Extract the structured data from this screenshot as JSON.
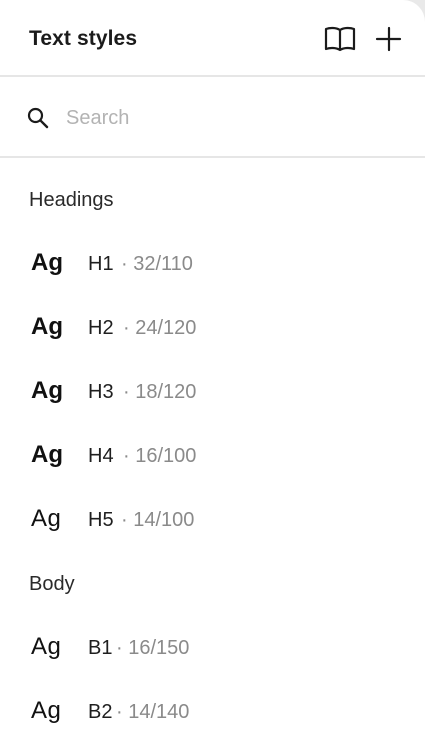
{
  "panel": {
    "title": "Text styles",
    "actions": [
      {
        "name": "book-icon"
      },
      {
        "name": "plus-icon"
      }
    ]
  },
  "search": {
    "placeholder": "Search",
    "value": "",
    "icon": "search-icon"
  },
  "groups": [
    {
      "label": "Headings",
      "items": [
        {
          "preview": "Ag",
          "name": "H1",
          "meta": "· 32/110"
        },
        {
          "preview": "Ag",
          "name": "H2",
          "meta": "· 24/120"
        },
        {
          "preview": "Ag",
          "name": "H3",
          "meta": "· 18/120"
        },
        {
          "preview": "Ag",
          "name": "H4",
          "meta": "· 16/100"
        },
        {
          "preview": "Ag",
          "name": "H5",
          "meta": "· 14/100"
        }
      ]
    },
    {
      "label": "Body",
      "items": [
        {
          "preview": "Ag",
          "name": "B1",
          "meta": "· 16/150"
        },
        {
          "preview": "Ag",
          "name": "B2",
          "meta": "· 14/140"
        }
      ]
    }
  ]
}
